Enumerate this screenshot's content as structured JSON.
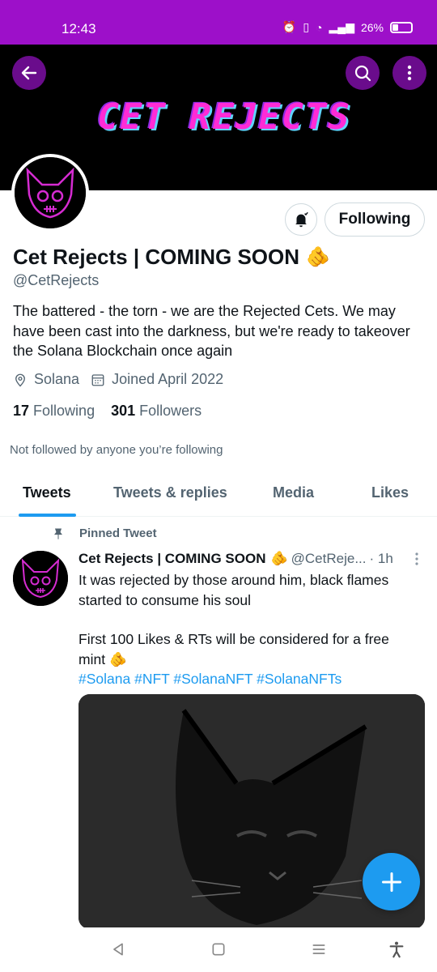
{
  "status_bar": {
    "time": "12:43",
    "battery": "26%"
  },
  "banner": {
    "logo_text": "CET REJECTS"
  },
  "profile": {
    "name": "Cet Rejects | COMING SOON",
    "name_emoji": "🫵",
    "handle": "@CetRejects",
    "bio": "The battered - the torn - we are the Rejected Cets. We may have been cast into the darkness, but we're ready to takeover the Solana Blockchain once again",
    "location": "Solana",
    "joined": "Joined April 2022",
    "following_count": "17",
    "following_label": "Following",
    "followers_count": "301",
    "followers_label": "Followers",
    "not_followed": "Not followed by anyone you’re following"
  },
  "buttons": {
    "following": "Following"
  },
  "tabs": [
    {
      "label": "Tweets"
    },
    {
      "label": "Tweets & replies"
    },
    {
      "label": "Media"
    },
    {
      "label": "Likes"
    }
  ],
  "pinned_tweet": {
    "label": "Pinned Tweet",
    "author": "Cet Rejects | COMING SOON",
    "author_emoji": "🫵",
    "handle": "@CetReje...",
    "time": "· 1h",
    "text_line1": "It was rejected by those around him, black flames started to consume his soul",
    "text_line2": "First 100 Likes & RTs will be considered for a free mint",
    "text_emoji": "🫵",
    "hashtags": "#Solana #NFT #SolanaNFT #SolanaNFTs"
  },
  "colors": {
    "accent": "#1d9bf0",
    "status_bar": "#9d10c9",
    "logo": "#ff2bd6"
  }
}
